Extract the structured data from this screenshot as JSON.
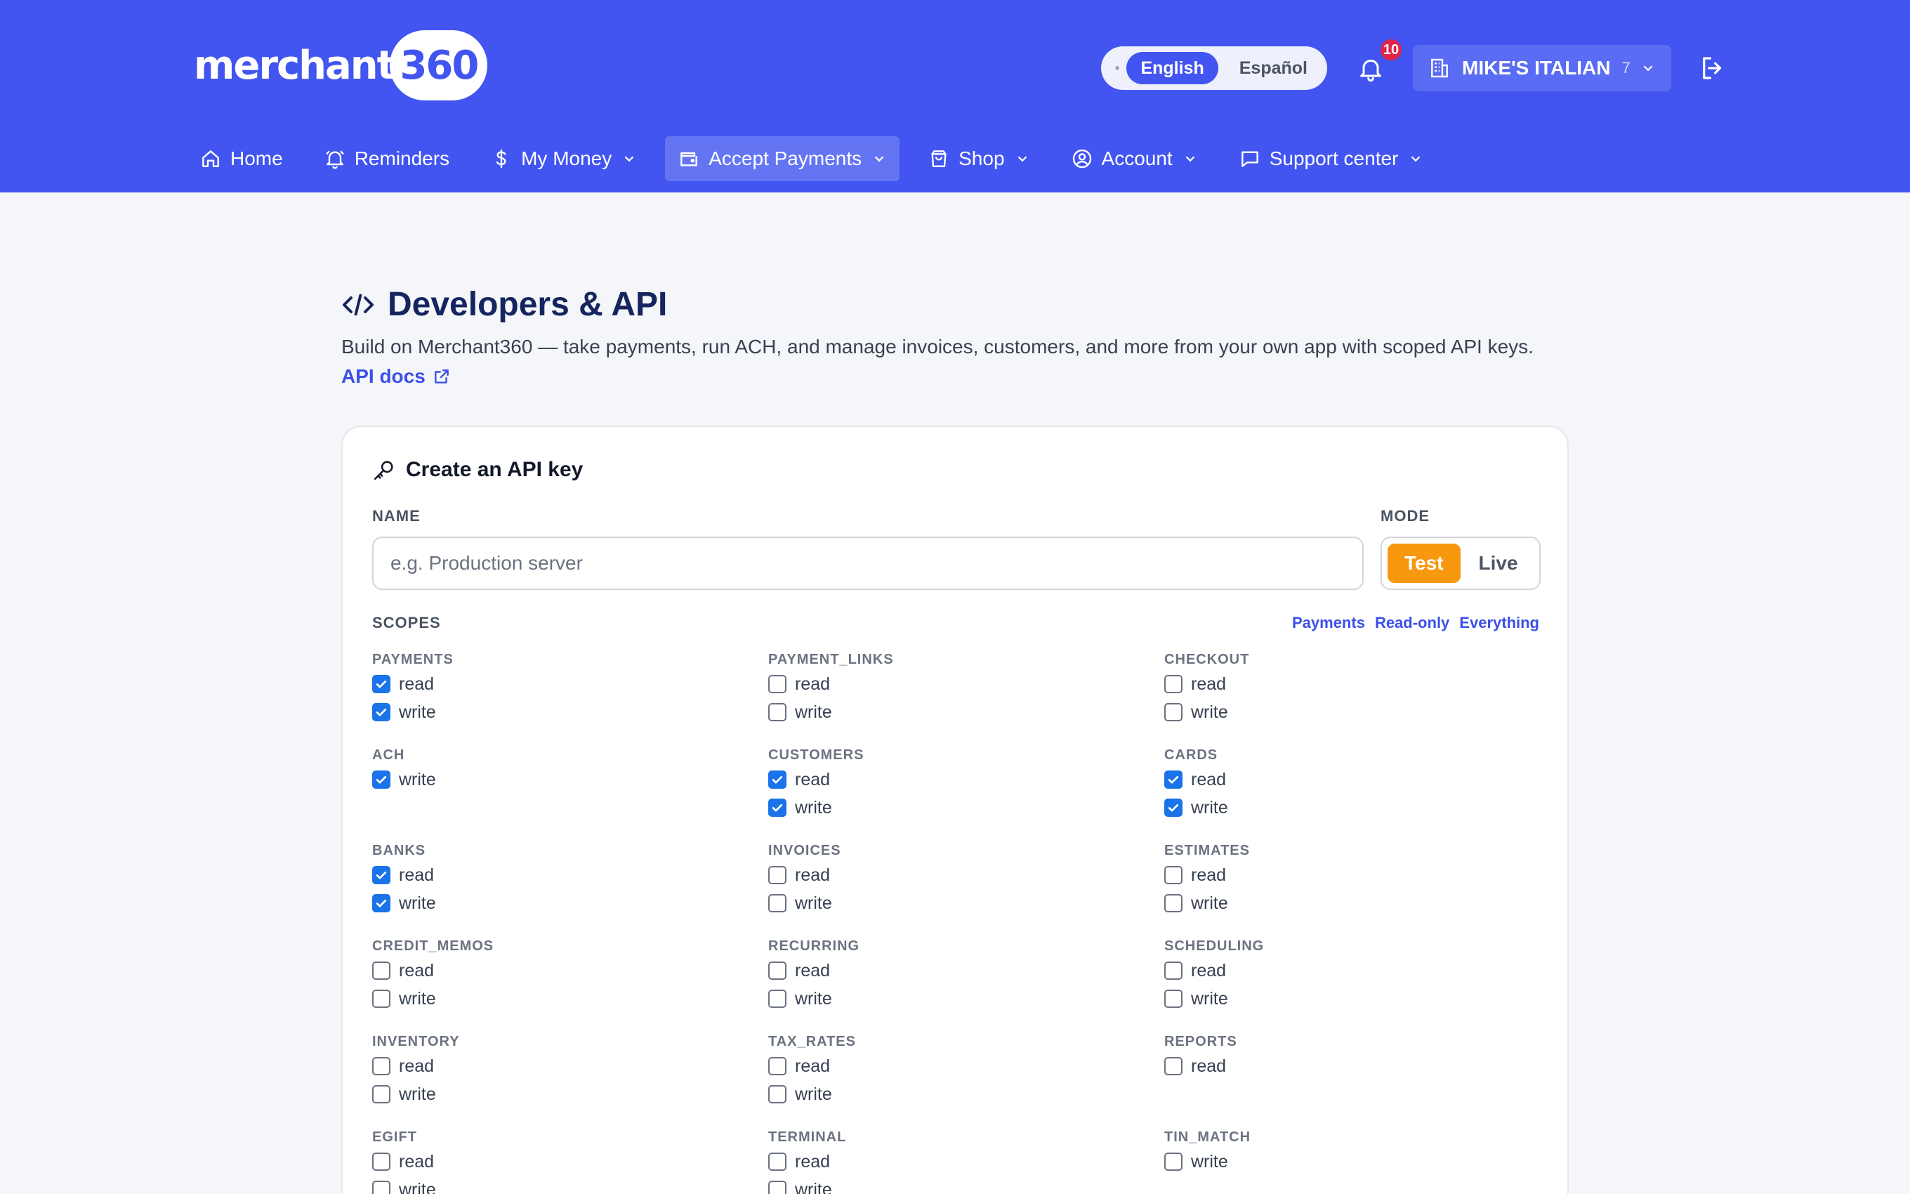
{
  "header": {
    "logo_text": "merchant",
    "logo_number": "360",
    "languages": [
      {
        "label": "English",
        "active": true
      },
      {
        "label": "Español",
        "active": false
      }
    ],
    "notifications_count": "10",
    "merchant_name": "MIKE'S ITALIAN",
    "merchant_count": "7"
  },
  "nav": [
    {
      "label": "Home",
      "icon": "home-icon",
      "dropdown": false,
      "active": false
    },
    {
      "label": "Reminders",
      "icon": "bell-icon",
      "dropdown": false,
      "active": false
    },
    {
      "label": "My Money",
      "icon": "dollar-icon",
      "dropdown": true,
      "active": false
    },
    {
      "label": "Accept Payments",
      "icon": "wallet-icon",
      "dropdown": true,
      "active": true
    },
    {
      "label": "Shop",
      "icon": "shopping-bag-icon",
      "dropdown": true,
      "active": false
    },
    {
      "label": "Account",
      "icon": "user-circle-icon",
      "dropdown": true,
      "active": false
    },
    {
      "label": "Support center",
      "icon": "chat-icon",
      "dropdown": true,
      "active": false
    }
  ],
  "page": {
    "title": "Developers & API",
    "subtitle": "Build on Merchant360 — take payments, run ACH, and manage invoices, customers, and more from your own app with scoped API keys.",
    "docs_link": "API docs"
  },
  "form": {
    "card_title": "Create an API key",
    "name_label": "NAME",
    "name_placeholder": "e.g. Production server",
    "name_value": "",
    "mode_label": "MODE",
    "mode_options": [
      {
        "label": "Test",
        "selected": true
      },
      {
        "label": "Live",
        "selected": false
      }
    ],
    "scopes_label": "SCOPES",
    "presets": [
      "Payments",
      "Read-only",
      "Everything"
    ]
  },
  "scopes": [
    {
      "name": "PAYMENTS",
      "perms": [
        {
          "label": "read",
          "checked": true
        },
        {
          "label": "write",
          "checked": true
        }
      ]
    },
    {
      "name": "PAYMENT_LINKS",
      "perms": [
        {
          "label": "read",
          "checked": false
        },
        {
          "label": "write",
          "checked": false
        }
      ]
    },
    {
      "name": "CHECKOUT",
      "perms": [
        {
          "label": "read",
          "checked": false
        },
        {
          "label": "write",
          "checked": false
        }
      ]
    },
    {
      "name": "ACH",
      "perms": [
        {
          "label": "write",
          "checked": true
        }
      ]
    },
    {
      "name": "CUSTOMERS",
      "perms": [
        {
          "label": "read",
          "checked": true
        },
        {
          "label": "write",
          "checked": true
        }
      ]
    },
    {
      "name": "CARDS",
      "perms": [
        {
          "label": "read",
          "checked": true
        },
        {
          "label": "write",
          "checked": true
        }
      ]
    },
    {
      "name": "BANKS",
      "perms": [
        {
          "label": "read",
          "checked": true
        },
        {
          "label": "write",
          "checked": true
        }
      ]
    },
    {
      "name": "INVOICES",
      "perms": [
        {
          "label": "read",
          "checked": false
        },
        {
          "label": "write",
          "checked": false
        }
      ]
    },
    {
      "name": "ESTIMATES",
      "perms": [
        {
          "label": "read",
          "checked": false
        },
        {
          "label": "write",
          "checked": false
        }
      ]
    },
    {
      "name": "CREDIT_MEMOS",
      "perms": [
        {
          "label": "read",
          "checked": false
        },
        {
          "label": "write",
          "checked": false
        }
      ]
    },
    {
      "name": "RECURRING",
      "perms": [
        {
          "label": "read",
          "checked": false
        },
        {
          "label": "write",
          "checked": false
        }
      ]
    },
    {
      "name": "SCHEDULING",
      "perms": [
        {
          "label": "read",
          "checked": false
        },
        {
          "label": "write",
          "checked": false
        }
      ]
    },
    {
      "name": "INVENTORY",
      "perms": [
        {
          "label": "read",
          "checked": false
        },
        {
          "label": "write",
          "checked": false
        }
      ]
    },
    {
      "name": "TAX_RATES",
      "perms": [
        {
          "label": "read",
          "checked": false
        },
        {
          "label": "write",
          "checked": false
        }
      ]
    },
    {
      "name": "REPORTS",
      "perms": [
        {
          "label": "read",
          "checked": false
        }
      ]
    },
    {
      "name": "EGIFT",
      "perms": [
        {
          "label": "read",
          "checked": false
        },
        {
          "label": "write",
          "checked": false
        }
      ]
    },
    {
      "name": "TERMINAL",
      "perms": [
        {
          "label": "read",
          "checked": false
        },
        {
          "label": "write",
          "checked": false
        }
      ]
    },
    {
      "name": "TIN_MATCH",
      "perms": [
        {
          "label": "write",
          "checked": false
        }
      ]
    }
  ]
}
